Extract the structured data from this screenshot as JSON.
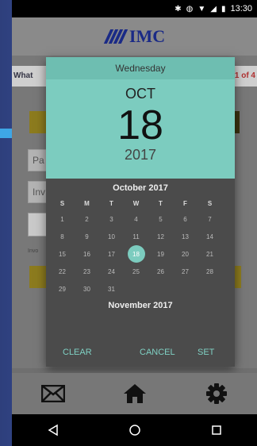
{
  "status_bar": {
    "time": "13:30"
  },
  "header": {
    "logo_text": "IMC"
  },
  "background": {
    "question_text": "What",
    "question_count": "1 of 4",
    "field1_placeholder": "Pa",
    "field2_placeholder": "Inv",
    "small_label": "Invo"
  },
  "date_picker": {
    "weekday": "Wednesday",
    "month": "OCT",
    "day": "18",
    "year": "2017",
    "calendar_title": "October 2017",
    "day_headers": [
      "S",
      "M",
      "T",
      "W",
      "T",
      "F",
      "S"
    ],
    "days": [
      "1",
      "2",
      "3",
      "4",
      "5",
      "6",
      "7",
      "8",
      "9",
      "10",
      "11",
      "12",
      "13",
      "14",
      "15",
      "16",
      "17",
      "18",
      "19",
      "20",
      "21",
      "22",
      "23",
      "24",
      "25",
      "26",
      "27",
      "28",
      "29",
      "30",
      "31"
    ],
    "selected_day": "18",
    "next_month_label": "November 2017",
    "clear_label": "CLEAR",
    "cancel_label": "CANCEL",
    "set_label": "SET",
    "accent_color": "#7cccbf"
  },
  "tab_bar": {
    "icons": [
      "mail-icon",
      "home-icon",
      "gear-icon"
    ]
  },
  "nav_bar": {
    "icons": [
      "back-icon",
      "home-circle-icon",
      "recents-icon"
    ]
  }
}
